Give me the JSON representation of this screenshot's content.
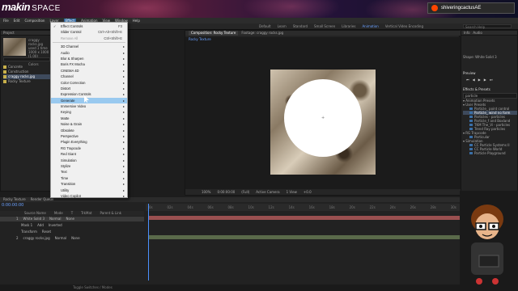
{
  "brand": {
    "name": "makin",
    "suffix": "SPACE"
  },
  "user": {
    "name": "shiveringcactusAE"
  },
  "menubar": [
    "File",
    "Edit",
    "Composition",
    "Layer",
    "Effect",
    "Animation",
    "View",
    "Window",
    "Help"
  ],
  "menubar_active": "Effect",
  "toolbar": {
    "workspaces": [
      "Default",
      "Learn",
      "Standard",
      "Small Screen",
      "Libraries",
      "Animation",
      "Vertical Video Encoding"
    ],
    "active_workspace": "Animation",
    "search": "Search Help"
  },
  "project": {
    "title": "Project",
    "file": "craggy rocks.jpg",
    "info1": "used 1 time",
    "info2": "1000 x 1000 (1.00)",
    "info3": "Millions of Colors",
    "items": [
      "Concrete",
      "Construction",
      "craggy rocks.jpg",
      "Rocky Texture"
    ],
    "selected": "craggy rocks.jpg"
  },
  "effects_menu": [
    {
      "label": "Effect Controls",
      "shortcut": "F3",
      "checked": true
    },
    {
      "label": "Slider Control",
      "shortcut": "Ctrl+Alt+Shift+E"
    },
    {
      "label": "Remove All",
      "shortcut": "Ctrl+Shift+E",
      "disabled": true
    },
    {
      "sep": true
    },
    {
      "label": "3D Channel",
      "sub": true
    },
    {
      "label": "Audio",
      "sub": true
    },
    {
      "label": "Blur & Sharpen",
      "sub": true
    },
    {
      "label": "Boris FX Mocha",
      "sub": true
    },
    {
      "label": "CINEMA 4D",
      "sub": true
    },
    {
      "label": "Channel",
      "sub": true
    },
    {
      "label": "Color Correction",
      "sub": true
    },
    {
      "label": "Distort",
      "sub": true
    },
    {
      "label": "Expression Controls",
      "sub": true
    },
    {
      "label": "Generate",
      "sub": true,
      "highlight": true
    },
    {
      "label": "Immersive Video",
      "sub": true
    },
    {
      "label": "Keying",
      "sub": true
    },
    {
      "label": "Matte",
      "sub": true
    },
    {
      "label": "Noise & Grain",
      "sub": true
    },
    {
      "label": "Obsolete",
      "sub": true
    },
    {
      "label": "Perspective",
      "sub": true
    },
    {
      "label": "Plugin Everything",
      "sub": true
    },
    {
      "label": "RG Trapcode",
      "sub": true
    },
    {
      "label": "Red Giant",
      "sub": true
    },
    {
      "label": "Simulation",
      "sub": true
    },
    {
      "label": "Stylize",
      "sub": true
    },
    {
      "label": "Text",
      "sub": true
    },
    {
      "label": "Time",
      "sub": true
    },
    {
      "label": "Transition",
      "sub": true
    },
    {
      "label": "Utility",
      "sub": true
    },
    {
      "label": "Video Copilot",
      "sub": true
    }
  ],
  "comp": {
    "tabs": [
      "Composition: Rocky Texture",
      "Footage: craggy rocks.jpg"
    ],
    "sub": "Rocky Texture",
    "zoom": "100%",
    "time": "0:00:00:00",
    "res": "(Full)",
    "camera": "Active Camera",
    "view": "1 View",
    "plus": "+0.0"
  },
  "right": {
    "info": "Info",
    "audio": "Audio",
    "shape": "Shape: White Solid 3",
    "preview": "Preview",
    "effects": "Effects & Presets",
    "search": "particle",
    "presets": "Animation Presets",
    "user": "User Presets",
    "list": [
      "Particle_ point control",
      "Particle_ wind no form",
      "Particles - particles",
      "Particle_f and Boxland",
      "TKM The_Vi - particles",
      "Trend Ray particles"
    ],
    "selected": "Particle_ wind no form",
    "rg": "RG Trapcode",
    "rg_item": "Particular",
    "sim": "Simulation",
    "sim_items": [
      "CC Particle Systems II",
      "CC Particle World",
      "Particle Playground"
    ]
  },
  "timeline": {
    "tabs": [
      "Rocky Texture",
      "Render Queue"
    ],
    "time": "0:00:00:00",
    "cols": [
      "Source Name",
      "Mode",
      "T",
      "TrkMat",
      "Parent & Link"
    ],
    "layers": [
      {
        "num": "1",
        "name": "White Solid 3",
        "mode": "Normal",
        "parent": "None"
      },
      {
        "num": "",
        "name": "Mask 1",
        "mode": "Add",
        "parent": "Inverted"
      },
      {
        "num": "",
        "name": "Transform",
        "mode": "Reset",
        "parent": ""
      },
      {
        "num": "2",
        "name": "craggy rocks.jpg",
        "mode": "Normal",
        "parent": "None"
      }
    ],
    "ruler": [
      "0s",
      "02s",
      "04s",
      "06s",
      "08s",
      "10s",
      "12s",
      "14s",
      "16s",
      "18s",
      "20s",
      "22s",
      "24s",
      "26s",
      "28s",
      "30s"
    ]
  },
  "status": "Toggle Switches / Modes"
}
